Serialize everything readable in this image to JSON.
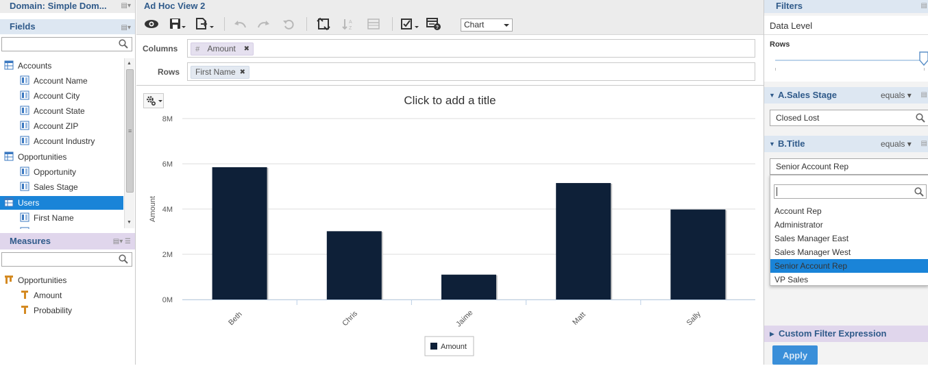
{
  "left": {
    "domain_title": "Domain: Simple Dom...",
    "fields_title": "Fields",
    "measures_title": "Measures",
    "fields": [
      {
        "label": "Accounts",
        "kind": "group"
      },
      {
        "label": "Account Name",
        "kind": "field"
      },
      {
        "label": "Account City",
        "kind": "field"
      },
      {
        "label": "Account State",
        "kind": "field"
      },
      {
        "label": "Account ZIP",
        "kind": "field"
      },
      {
        "label": "Account Industry",
        "kind": "field"
      },
      {
        "label": "Opportunities",
        "kind": "group"
      },
      {
        "label": "Opportunity",
        "kind": "field"
      },
      {
        "label": "Sales Stage",
        "kind": "field"
      },
      {
        "label": "Users",
        "kind": "group",
        "selected": true
      },
      {
        "label": "First Name",
        "kind": "field"
      }
    ],
    "measures": [
      {
        "label": "Opportunities",
        "kind": "group"
      },
      {
        "label": "Amount",
        "kind": "measure"
      },
      {
        "label": "Probability",
        "kind": "measure"
      }
    ]
  },
  "center": {
    "view_title": "Ad Hoc View 2",
    "chart_type_select": "Chart",
    "columns_label": "Columns",
    "rows_label": "Rows",
    "column_pill": "Amount",
    "column_pill_type": "#",
    "row_pill": "First Name",
    "chart_title": "Click to add a title"
  },
  "chart_data": {
    "type": "bar",
    "categories": [
      "Beth",
      "Chris",
      "Jaime",
      "Matt",
      "Sally"
    ],
    "series": [
      {
        "name": "Amount",
        "values": [
          5.85,
          3.02,
          1.1,
          5.15,
          3.98
        ]
      }
    ],
    "ylabel": "Amount",
    "ylim": [
      0,
      8
    ],
    "yticks": [
      "0M",
      "2M",
      "4M",
      "6M",
      "8M"
    ],
    "legend": "bottom-center",
    "grid": true,
    "color": "#0e2038"
  },
  "filters": {
    "title": "Filters",
    "data_level": "Data Level",
    "rows_label": "Rows",
    "filter_a": {
      "name": "A.Sales Stage",
      "operator": "equals",
      "value": "Closed Lost"
    },
    "filter_b": {
      "name": "B.Title",
      "operator": "equals",
      "value": "Senior Account Rep",
      "options": [
        "Account Rep",
        "Administrator",
        "Sales Manager East",
        "Sales Manager West",
        "Senior Account Rep",
        "VP Sales"
      ],
      "selected_index": 4
    },
    "custom_expression": "Custom Filter Expression",
    "apply": "Apply"
  }
}
